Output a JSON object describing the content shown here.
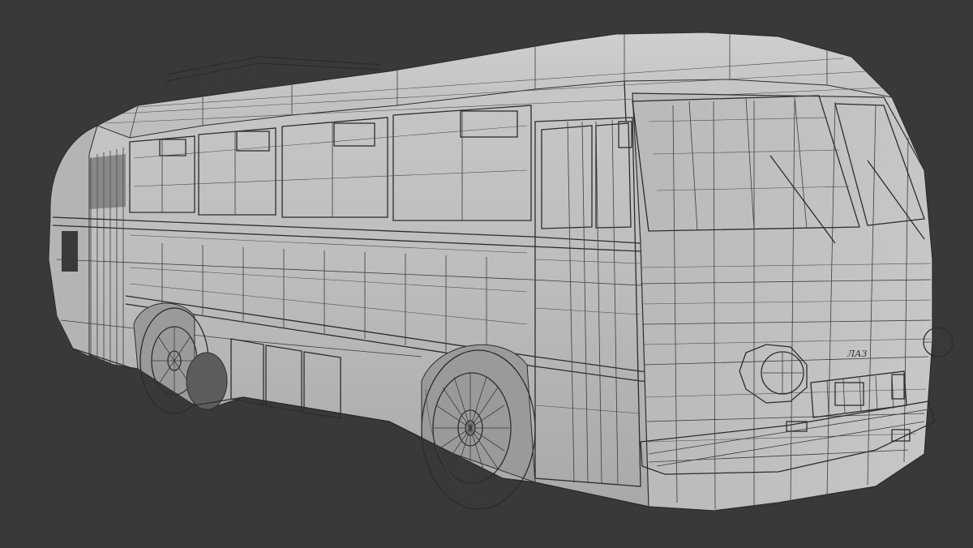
{
  "scene": {
    "background_color": "#393939",
    "model_color": "#bdbdbd",
    "model_shadow_color": "#a9a9a9",
    "wire_color": "#3c3c3c",
    "glass_color": "#c6c6c6"
  },
  "bus": {
    "front_badge": "ЛАЗ"
  }
}
